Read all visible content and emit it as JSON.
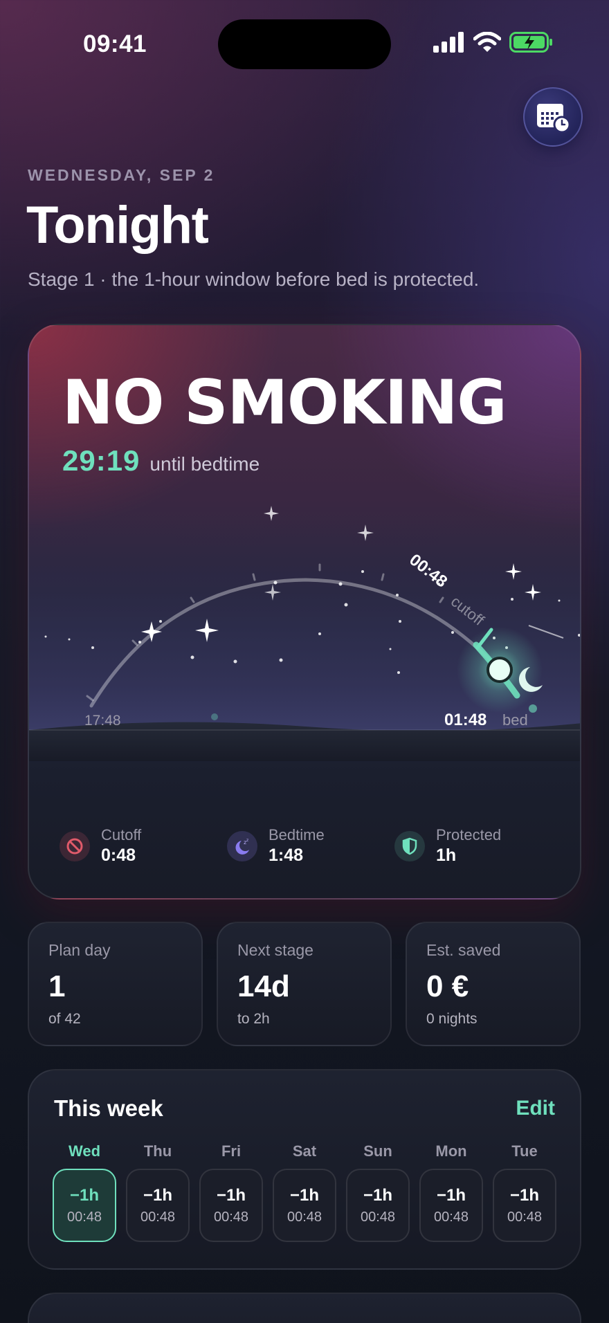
{
  "status_bar": {
    "time": "09:41"
  },
  "header": {
    "date": "WEDNESDAY, SEP 2",
    "title": "Tonight",
    "subtitle": "Stage 1 · the 1-hour window before bed is protected."
  },
  "hero": {
    "title": "NO SMOKING",
    "countdown": "29:19",
    "countdown_text": "until bedtime",
    "arc": {
      "start_time": "17:48",
      "cutoff_time": "00:48",
      "cutoff_label": "cutoff",
      "bed_time": "01:48",
      "bed_label": "bed",
      "progress": 0.9
    },
    "stats": [
      {
        "label": "Cutoff",
        "value": "0:48",
        "icon": "no-smoking-icon",
        "color": "#e05a6a"
      },
      {
        "label": "Bedtime",
        "value": "1:48",
        "icon": "moon-sleep-icon",
        "color": "#8a7cf0"
      },
      {
        "label": "Protected",
        "value": "1h",
        "icon": "shield-icon",
        "color": "#6fe0bd"
      }
    ]
  },
  "tiles": [
    {
      "label": "Plan day",
      "value": "1",
      "sub": "of 42"
    },
    {
      "label": "Next stage",
      "value": "14d",
      "sub": "to 2h"
    },
    {
      "label": "Est. saved",
      "value": "0 €",
      "sub": "0 nights"
    }
  ],
  "week": {
    "title": "This week",
    "edit_label": "Edit",
    "days": [
      {
        "name": "Wed",
        "delta": "−1h",
        "time": "00:48",
        "active": true
      },
      {
        "name": "Thu",
        "delta": "−1h",
        "time": "00:48"
      },
      {
        "name": "Fri",
        "delta": "−1h",
        "time": "00:48"
      },
      {
        "name": "Sat",
        "delta": "−1h",
        "time": "00:48"
      },
      {
        "name": "Sun",
        "delta": "−1h",
        "time": "00:48"
      },
      {
        "name": "Mon",
        "delta": "−1h",
        "time": "00:48"
      },
      {
        "name": "Tue",
        "delta": "−1h",
        "time": "00:48"
      }
    ]
  },
  "colors": {
    "accent": "#6fe0bd",
    "danger": "#e05a6a",
    "violet": "#8a7cf0"
  }
}
